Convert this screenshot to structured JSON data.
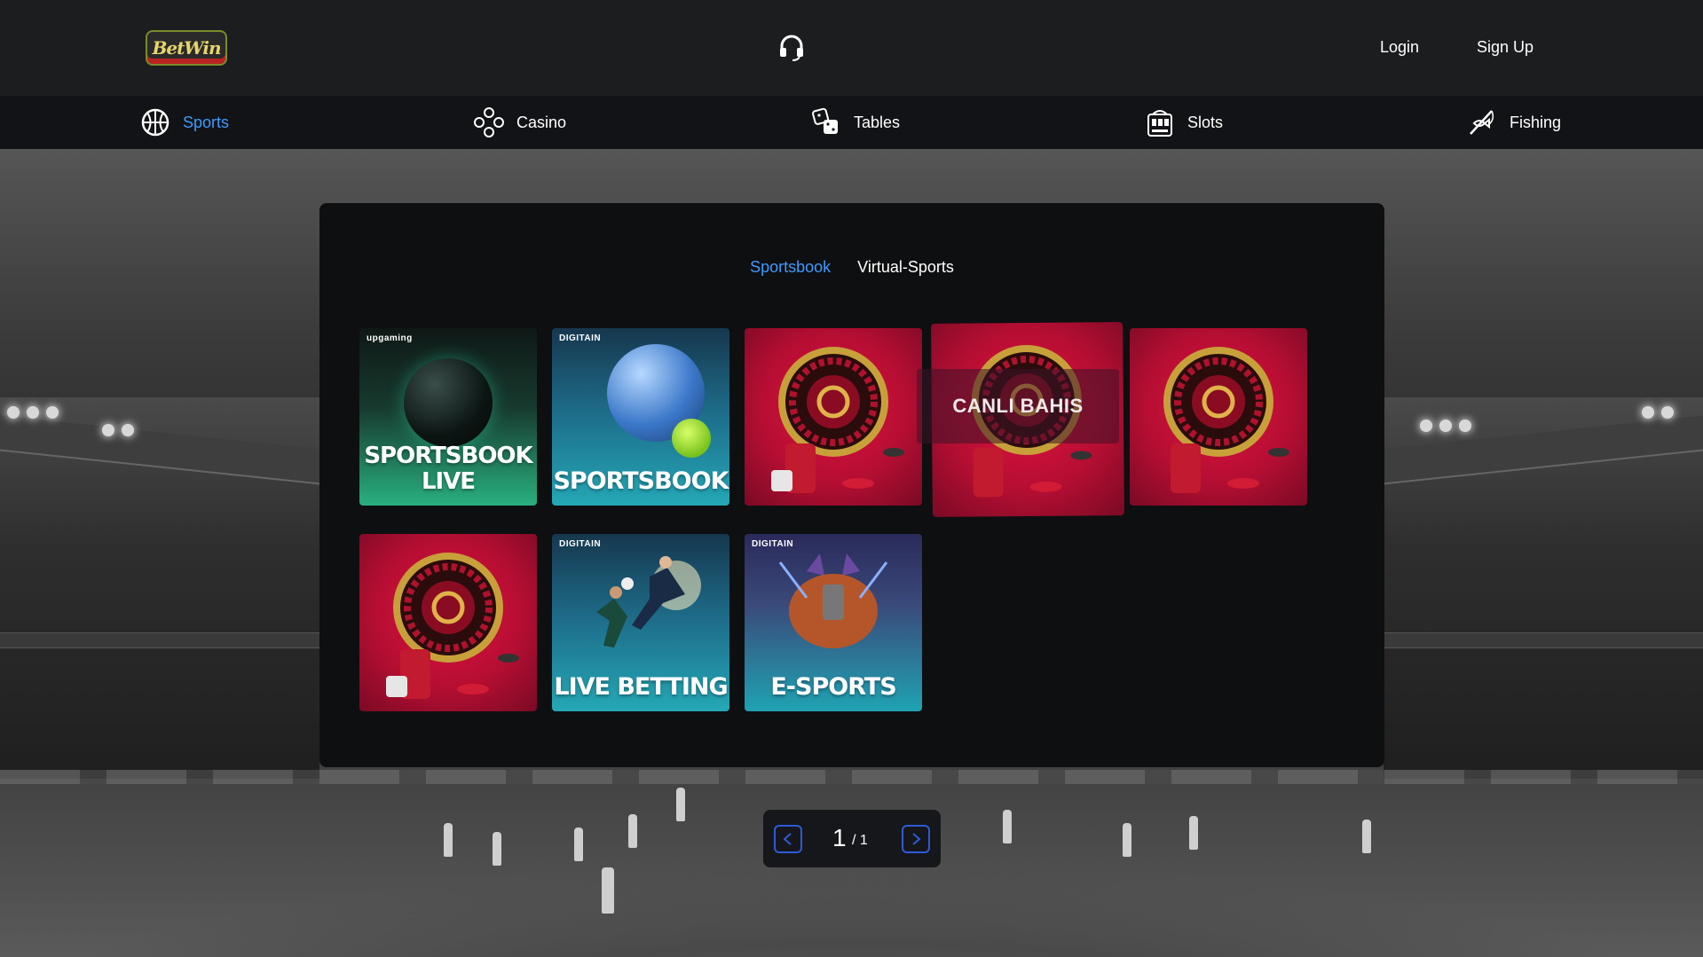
{
  "brand": {
    "logo_text": "BetWin"
  },
  "header": {
    "login": "Login",
    "signup": "Sign Up"
  },
  "nav": [
    {
      "label": "Sports",
      "active": true
    },
    {
      "label": "Casino"
    },
    {
      "label": "Tables"
    },
    {
      "label": "Slots"
    },
    {
      "label": "Fishing"
    }
  ],
  "tabs": [
    {
      "label": "Sportsbook",
      "active": true
    },
    {
      "label": "Virtual-Sports"
    }
  ],
  "games": [
    {
      "title": "SPORTSBOOK\nLIVE",
      "provider": "upgaming"
    },
    {
      "title": "SPORTSBOOK",
      "provider": "DIGITAIN"
    },
    {
      "title": ""
    },
    {
      "title": "CANLI BAHIS"
    },
    {
      "title": ""
    },
    {
      "title": ""
    },
    {
      "title": "LIVE BETTING",
      "provider": "DIGITAIN"
    },
    {
      "title": "E-SPORTS",
      "provider": "DIGITAIN"
    }
  ],
  "pagination": {
    "current": "1",
    "total": "/ 1"
  },
  "colors": {
    "accent": "#3d9bff",
    "header_bg": "#1c1d1f",
    "nav_bg": "#121316",
    "panel_bg": "#0e0f11"
  }
}
